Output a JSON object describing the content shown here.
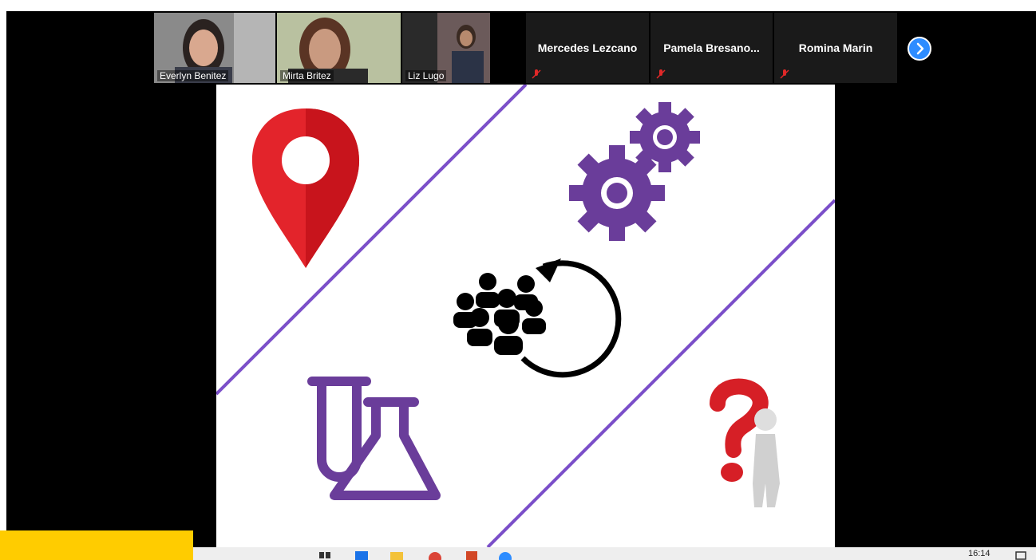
{
  "participants": [
    {
      "name": "Everlyn Benitez",
      "video": true
    },
    {
      "name": "Mirta Britez",
      "video": true,
      "active": true
    },
    {
      "name": "Liz Lugo",
      "video": true
    },
    {
      "name": "Mercedes Lezcano",
      "video": false,
      "muted": true
    },
    {
      "name": "Pamela  Bresano...",
      "video": false,
      "muted": true
    },
    {
      "name": "Romina Marin",
      "video": false,
      "muted": true
    }
  ],
  "icons": {
    "next": "chevron-right-icon",
    "pin": "location-pin-icon",
    "gears": "gears-icon",
    "people": "people-cycle-icon",
    "lab": "lab-flask-icon",
    "question": "question-figure-icon"
  },
  "colors": {
    "accent": "#2d8cff",
    "purple": "#6a3d9a",
    "red": "#e3242b",
    "active_border": "#7cc142",
    "taskbar_highlight": "#ffcc00"
  },
  "taskbar": {
    "clock": "16:14"
  }
}
